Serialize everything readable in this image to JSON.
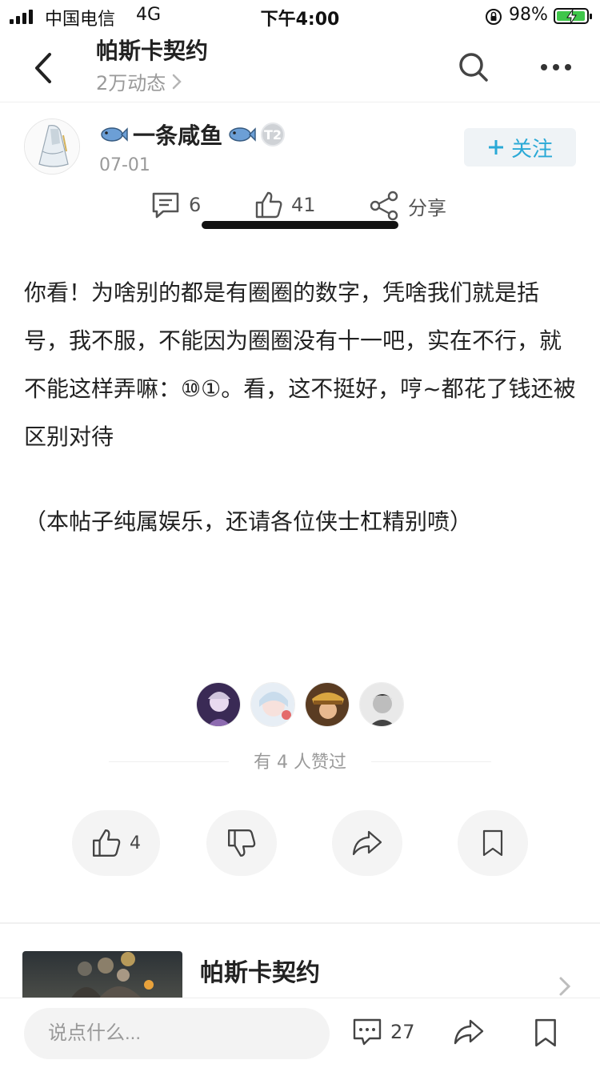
{
  "status_bar": {
    "carrier": "中国电信",
    "network": "4G",
    "time": "下午4:00",
    "battery": "98%",
    "battery_level": 0.98
  },
  "nav": {
    "title": "帕斯卡契约",
    "subtitle": "2万动态",
    "icons": [
      "back-arrow-icon",
      "search-icon",
      "more-icon"
    ]
  },
  "post": {
    "author": "一条咸鱼",
    "badge": "T2",
    "date": "07-01",
    "follow_label": "关注",
    "comments": "6",
    "likes": "41",
    "share_label": "分享",
    "body": "你看！为啥别的都是有圈圈的数字，凭啥我们就是括号，我不服，不能因为圈圈没有十一吧，实在不行，就不能这样弄嘛：⑩①。看，这不挺好，哼~都花了钱还被区别对待",
    "note": "（本帖子纯属娱乐，还请各位侠士杠精别喷）"
  },
  "likers": {
    "text": "有 4 人赞过",
    "count": 4
  },
  "actions": {
    "like_count": "4"
  },
  "related_game": {
    "name": "帕斯卡契约"
  },
  "bottom_bar": {
    "placeholder": "说点什么...",
    "comment_count": "27"
  },
  "colors": {
    "accent": "#2aa9d6",
    "follow_bg": "#eff3f6",
    "battery": "#3fc64a",
    "muted_text": "#9a9a9a"
  }
}
